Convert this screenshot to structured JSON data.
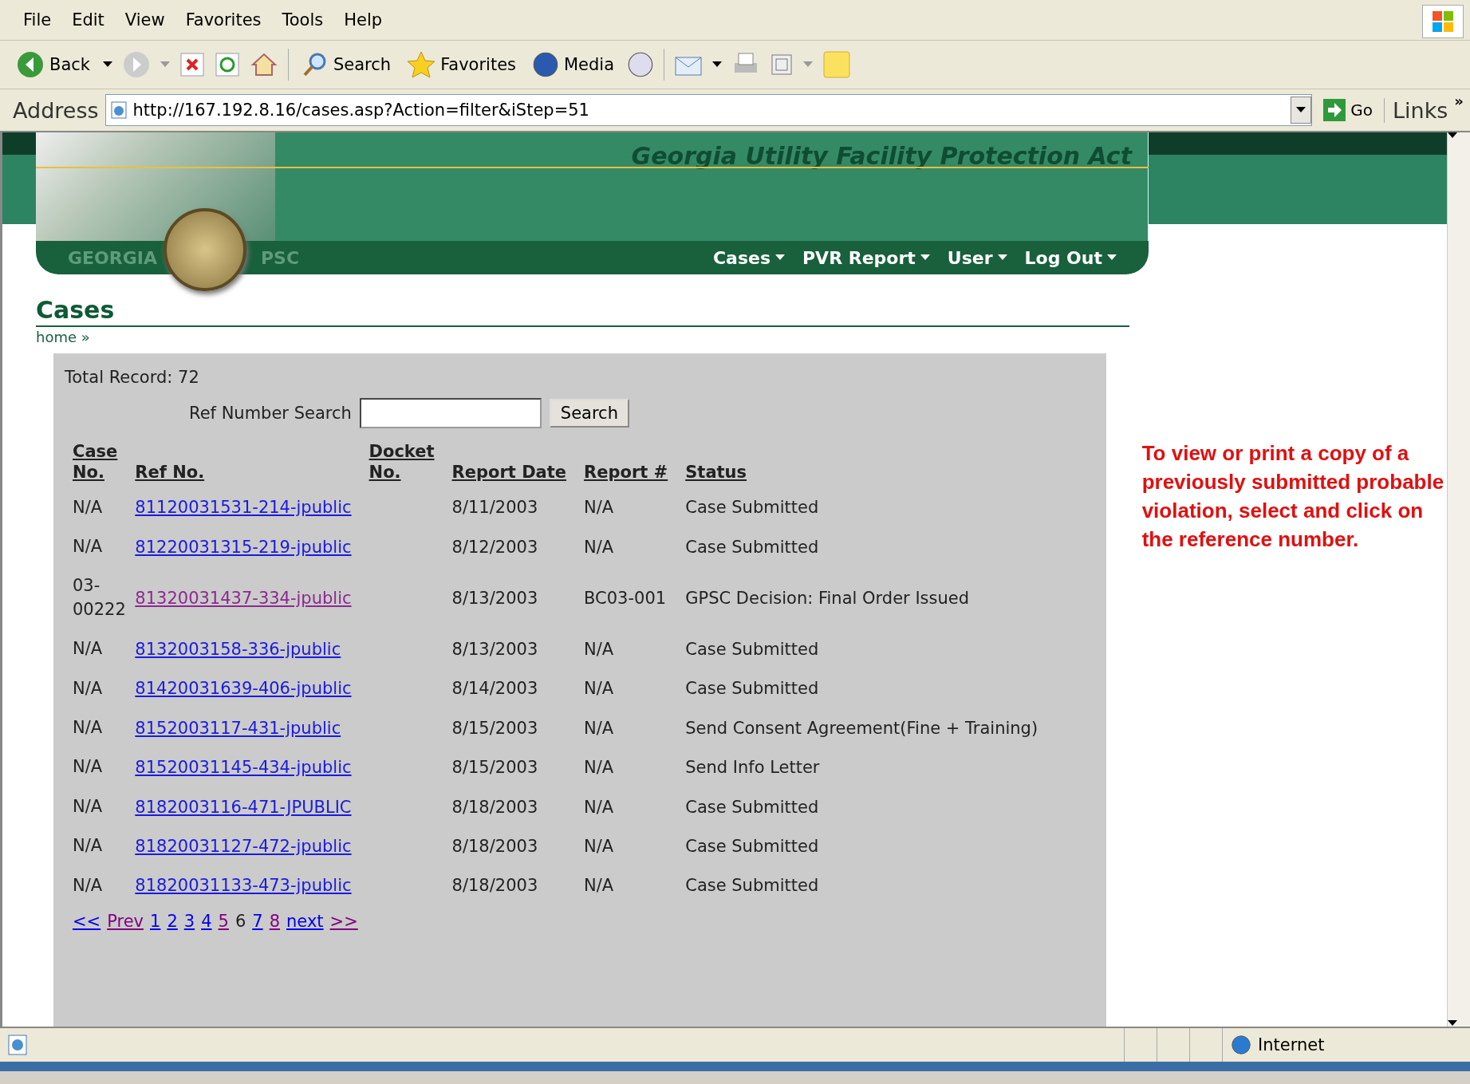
{
  "menu_bar": [
    "File",
    "Edit",
    "View",
    "Favorites",
    "Tools",
    "Help"
  ],
  "toolbar": {
    "back": "Back",
    "search": "Search",
    "favorites": "Favorites",
    "media": "Media"
  },
  "address_bar": {
    "label": "Address",
    "url": "http://167.192.8.16/cases.asp?Action=filter&iStep=51",
    "go": "Go",
    "links": "Links",
    "more": "»"
  },
  "header": {
    "title": "Georgia Utility Facility Protection Act",
    "left_text": "GEORGIA",
    "right_text": "PSC",
    "nav": [
      "Cases",
      "PVR Report",
      "User",
      "Log Out"
    ]
  },
  "page": {
    "heading": "Cases",
    "breadcrumb": "home »"
  },
  "panel": {
    "total": "Total Record: 72",
    "search_label": "Ref Number Search",
    "search_button": "Search",
    "columns": [
      "Case No.",
      "Ref No.",
      "Docket No.",
      "Report Date",
      "Report #",
      "Status"
    ],
    "rows": [
      {
        "case_no": "N/A",
        "ref_no": "81120031531-214-jpublic",
        "visited": false,
        "report_date": "8/11/2003",
        "report_no": "N/A",
        "status": "Case Submitted"
      },
      {
        "case_no": "N/A",
        "ref_no": "81220031315-219-jpublic",
        "visited": false,
        "report_date": "8/12/2003",
        "report_no": "N/A",
        "status": "Case Submitted"
      },
      {
        "case_no": "03-00222",
        "ref_no": "81320031437-334-jpublic",
        "visited": true,
        "report_date": "8/13/2003",
        "report_no": "BC03-001",
        "status": "GPSC Decision: Final Order Issued"
      },
      {
        "case_no": "N/A",
        "ref_no": "8132003158-336-jpublic",
        "visited": false,
        "report_date": "8/13/2003",
        "report_no": "N/A",
        "status": "Case Submitted"
      },
      {
        "case_no": "N/A",
        "ref_no": "81420031639-406-jpublic",
        "visited": false,
        "report_date": "8/14/2003",
        "report_no": "N/A",
        "status": "Case Submitted"
      },
      {
        "case_no": "N/A",
        "ref_no": "8152003117-431-jpublic",
        "visited": false,
        "report_date": "8/15/2003",
        "report_no": "N/A",
        "status": "Send Consent Agreement(Fine + Training)"
      },
      {
        "case_no": "N/A",
        "ref_no": "81520031145-434-jpublic",
        "visited": false,
        "report_date": "8/15/2003",
        "report_no": "N/A",
        "status": "Send Info Letter"
      },
      {
        "case_no": "N/A",
        "ref_no": "8182003116-471-JPUBLIC",
        "visited": false,
        "report_date": "8/18/2003",
        "report_no": "N/A",
        "status": "Case Submitted"
      },
      {
        "case_no": "N/A",
        "ref_no": "81820031127-472-jpublic",
        "visited": false,
        "report_date": "8/18/2003",
        "report_no": "N/A",
        "status": "Case Submitted"
      },
      {
        "case_no": "N/A",
        "ref_no": "81820031133-473-jpublic",
        "visited": false,
        "report_date": "8/18/2003",
        "report_no": "N/A",
        "status": "Case Submitted"
      }
    ],
    "pagination": [
      {
        "label": "<<",
        "kind": "link",
        "visited": false
      },
      {
        "label": "Prev",
        "kind": "link",
        "visited": true
      },
      {
        "label": "1",
        "kind": "link",
        "visited": false
      },
      {
        "label": "2",
        "kind": "link",
        "visited": false
      },
      {
        "label": "3",
        "kind": "link",
        "visited": false
      },
      {
        "label": "4",
        "kind": "link",
        "visited": false
      },
      {
        "label": "5",
        "kind": "link",
        "visited": true
      },
      {
        "label": "6",
        "kind": "current"
      },
      {
        "label": "7",
        "kind": "link",
        "visited": false
      },
      {
        "label": "8",
        "kind": "link",
        "visited": true
      },
      {
        "label": "next",
        "kind": "link",
        "visited": false
      },
      {
        "label": ">>",
        "kind": "link",
        "visited": true
      }
    ]
  },
  "note": "To view or print a copy of a previously submitted probable violation, select and click on the reference number.",
  "status_bar": {
    "zone": "Internet"
  }
}
